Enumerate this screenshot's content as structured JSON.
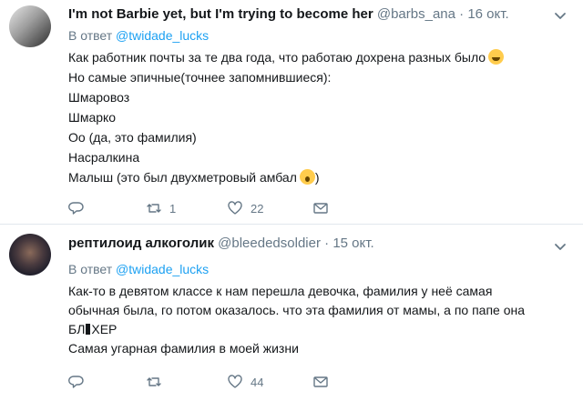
{
  "tweets": [
    {
      "name": "I'm not Barbiе yet, but I'm trying to become her",
      "handle": "@barbs_ana",
      "separator": "·",
      "date": "16 окт.",
      "reply_prefix": "В ответ",
      "reply_to": "@twidade_lucks",
      "lines": [
        "Как работник почты за те два года, что работаю дохрена разных было",
        "Но самые эпичные(точнее запомнившиеся):",
        "Шмаровоз",
        "Шмарко",
        "Оо (да, это фамилия)",
        "Насралкина",
        "Малыш (это был двухметровый амбал"
      ],
      "line_end": ")",
      "retweets": "1",
      "likes": "22"
    },
    {
      "name": "рептилоид алкоголик",
      "handle": "@bleededsoldier",
      "separator": "·",
      "date": "15 окт.",
      "reply_prefix": "В ответ",
      "reply_to": "@twidade_lucks",
      "lines": [
        "Как-то в девятом классе к нам перешла девочка, фамилия у неё самая",
        "обычная была, го потом оказалось. что эта фамилия от мамы, а по папе она",
        "БЛ",
        "ХЕР",
        "Самая угарная фамилия в моей жизни"
      ],
      "likes": "44"
    }
  ],
  "icons": {
    "reply": "reply-icon",
    "retweet": "retweet-icon",
    "like": "heart-icon",
    "dm": "envelope-icon",
    "more": "chevron-down-icon"
  },
  "colors": {
    "text": "#14171a",
    "secondary": "#657786",
    "accent": "#1da1f2",
    "divider": "#e1e8ed"
  }
}
